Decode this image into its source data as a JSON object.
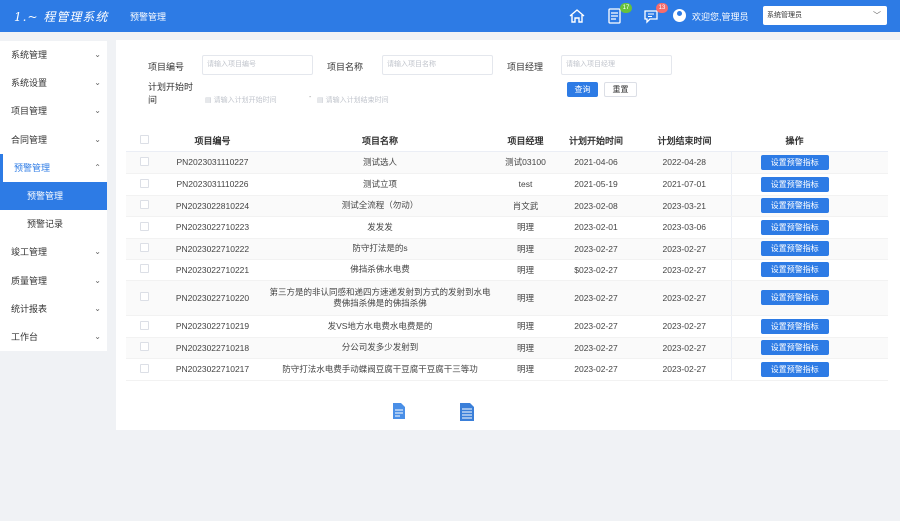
{
  "header": {
    "brand": "1.~ 程管理系统",
    "module": "预警管理",
    "badge_todo": "17",
    "badge_msg": "13",
    "welcome": "欢迎您,管理员",
    "role": "系统管理员"
  },
  "sidebar": {
    "items": [
      {
        "label": "系统管理"
      },
      {
        "label": "系统设置"
      },
      {
        "label": "项目管理"
      },
      {
        "label": "合同管理"
      },
      {
        "label": "预警管理"
      },
      {
        "label": "竣工管理"
      },
      {
        "label": "质量管理"
      },
      {
        "label": "统计报表"
      },
      {
        "label": "工作台"
      }
    ],
    "sub_items": [
      {
        "label": "预警管理"
      },
      {
        "label": "预警记录"
      }
    ]
  },
  "filters": {
    "code_label": "项目编号",
    "code_placeholder": "请输入项目编号",
    "name_label": "项目名称",
    "name_placeholder": "请输入项目名称",
    "manager_label": "项目经理",
    "manager_placeholder": "请输入项目经理",
    "plan_label_1": "计划开始时",
    "plan_label_2": "间",
    "start_placeholder": "请输入计划开始时间",
    "end_placeholder": "请输入计划结束时间",
    "search_btn": "查询",
    "reset_btn": "重置"
  },
  "table": {
    "columns": [
      "项目编号",
      "项目名称",
      "项目经理",
      "计划开始时间",
      "计划结束时间",
      "操作"
    ],
    "action_label": "设置预警指标",
    "rows": [
      {
        "code": "PN2023031110227",
        "name": "测试选人",
        "manager": "测试03100",
        "start": "2021-04-06",
        "end": "2022-04-28"
      },
      {
        "code": "PN2023031110226",
        "name": "测试立项",
        "manager": "test",
        "start": "2021-05-19",
        "end": "2021-07-01"
      },
      {
        "code": "PN2023022810224",
        "name": "测试全流程（勿动）",
        "manager": "肖文武",
        "start": "2023-02-08",
        "end": "2023-03-21"
      },
      {
        "code": "PN2023022710223",
        "name": "发发发",
        "manager": "明理",
        "start": "2023-02-01",
        "end": "2023-03-06"
      },
      {
        "code": "PN2023022710222",
        "name": "防守打法是的s",
        "manager": "明理",
        "start": "2023-02-27",
        "end": "2023-02-27"
      },
      {
        "code": "PN2023022710221",
        "name": "佛挡杀佛水电费",
        "manager": "明理",
        "start": "$023-02-27",
        "end": "2023-02-27"
      },
      {
        "code": "PN2023022710220",
        "name": "第三方是的非认同感和递四方速递发射到方式的发射到水电费佛挡杀佛是的佛挡杀佛",
        "manager": "明理",
        "start": "2023-02-27",
        "end": "2023-02-27"
      },
      {
        "code": "PN2023022710219",
        "name": "发VS地方水电费水电费是的",
        "manager": "明理",
        "start": "2023-02-27",
        "end": "2023-02-27"
      },
      {
        "code": "PN2023022710218",
        "name": "分公司发多少发射到",
        "manager": "明理",
        "start": "2023-02-27",
        "end": "2023-02-27"
      },
      {
        "code": "PN2023022710217",
        "name": "防守打法水电费手动蝶阀豆腐干豆腐干豆腐干三等功",
        "manager": "明理",
        "start": "2023-02-27",
        "end": "2023-02-27"
      }
    ]
  },
  "colors": {
    "primary": "#2d7be5",
    "badge_green": "#67c23a",
    "badge_red": "#f56c6c"
  }
}
